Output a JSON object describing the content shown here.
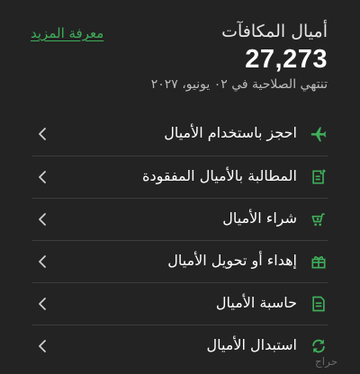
{
  "header": {
    "title": "أميال المكافآت",
    "miles": "27,273",
    "expiry": "تنتهي الصلاحية في ٠٢ يونيو، ٢٠٢٧",
    "learn_more": "معرفة المزيد"
  },
  "menu": {
    "items": [
      {
        "label": "احجز باستخدام الأميال",
        "icon": "airplane-icon"
      },
      {
        "label": "المطالبة بالأميال المفقودة",
        "icon": "document-plus-icon"
      },
      {
        "label": "شراء الأميال",
        "icon": "cart-icon"
      },
      {
        "label": "إهداء أو تحويل الأميال",
        "icon": "gift-icon"
      },
      {
        "label": "حاسبة الأميال",
        "icon": "calculator-document-icon"
      },
      {
        "label": "استبدال الأميال",
        "icon": "exchange-arrows-icon"
      }
    ]
  },
  "colors": {
    "background": "#232323",
    "accent": "#3fae5a",
    "divider": "#3c3c3c"
  },
  "watermark": "حراج"
}
